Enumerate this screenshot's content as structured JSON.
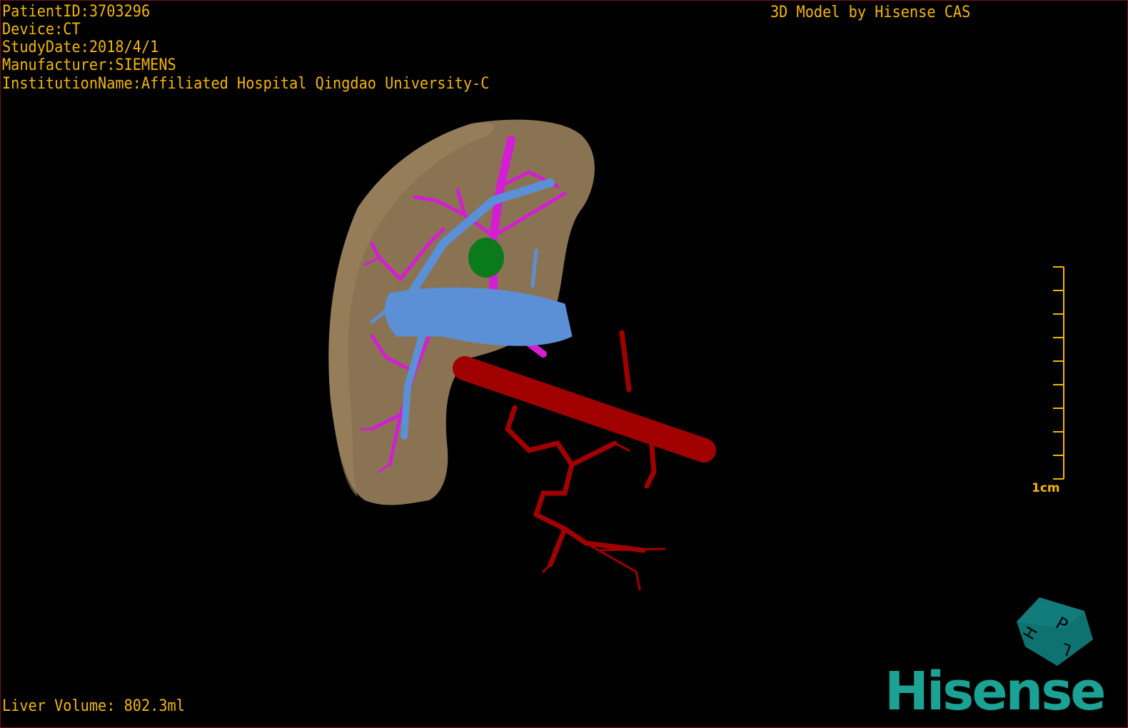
{
  "header": {
    "patient_id": "PatientID:3703296",
    "device": "Device:CT",
    "study_date": "StudyDate:2018/4/1",
    "manufacturer": "Manufacturer:SIEMENS",
    "institution": "InstitutionName:Affiliated Hospital Qingdao University-C",
    "title": "3D Model by Hisense CAS"
  },
  "footer": {
    "liver_volume": "Liver Volume: 802.3ml"
  },
  "scale_bar": {
    "label": "1cm",
    "divisions": 9
  },
  "orientation_cube": {
    "labels": [
      "P",
      "H",
      "L"
    ]
  },
  "logo": {
    "text": "Hisense"
  },
  "colors": {
    "overlay_text": "#f2b705",
    "liver": "#8a7352",
    "portal_vein": "#5b8fd6",
    "hepatic_vessels": "#d41ed4",
    "artery": "#a00000",
    "lesion": "#0a7a1a",
    "brand": "#1aa294"
  }
}
